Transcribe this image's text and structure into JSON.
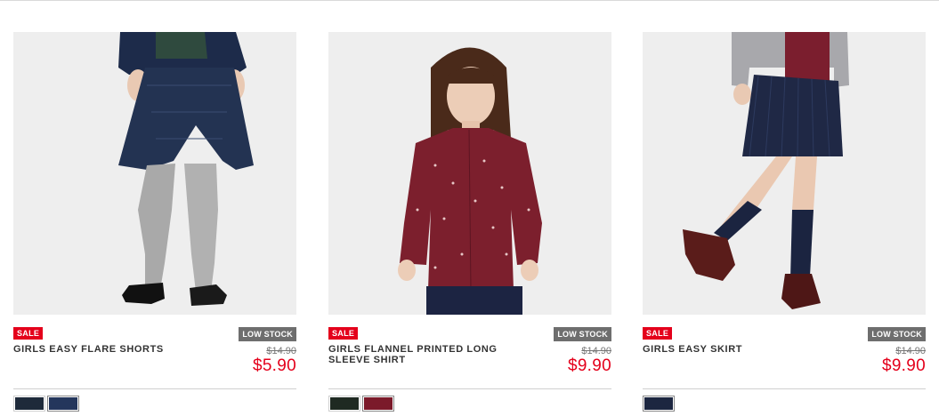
{
  "products": [
    {
      "sale_badge": "SALE",
      "stock_badge": "LOW STOCK",
      "name": "GIRLS EASY FLARE SHORTS",
      "old_price": "$14.90",
      "price": "$5.90",
      "image_icon": "flare-shorts-photo",
      "swatches": [
        {
          "color": "#1e2a3a",
          "pattern": "plaid-dark"
        },
        {
          "color": "#24365c",
          "pattern": "navy",
          "selected": true
        }
      ]
    },
    {
      "sale_badge": "SALE",
      "stock_badge": "LOW STOCK",
      "name": "GIRLS FLANNEL PRINTED LONG SLEEVE SHIRT",
      "old_price": "$14.90",
      "price": "$9.90",
      "image_icon": "flannel-shirt-photo",
      "swatches": [
        {
          "color": "#1f2a22",
          "pattern": "green-dark"
        },
        {
          "color": "#7b1a2a",
          "pattern": "burgundy",
          "selected": true
        }
      ]
    },
    {
      "sale_badge": "SALE",
      "stock_badge": "LOW STOCK",
      "name": "GIRLS EASY SKIRT",
      "old_price": "$14.90",
      "price": "$9.90",
      "image_icon": "easy-skirt-photo",
      "swatches": [
        {
          "color": "#1c2640",
          "pattern": "navy",
          "selected": true
        }
      ]
    }
  ],
  "colors": {
    "sale_red": "#e4001b",
    "low_stock_gray": "#6e6e6e",
    "photo_bg": "#ededed"
  }
}
